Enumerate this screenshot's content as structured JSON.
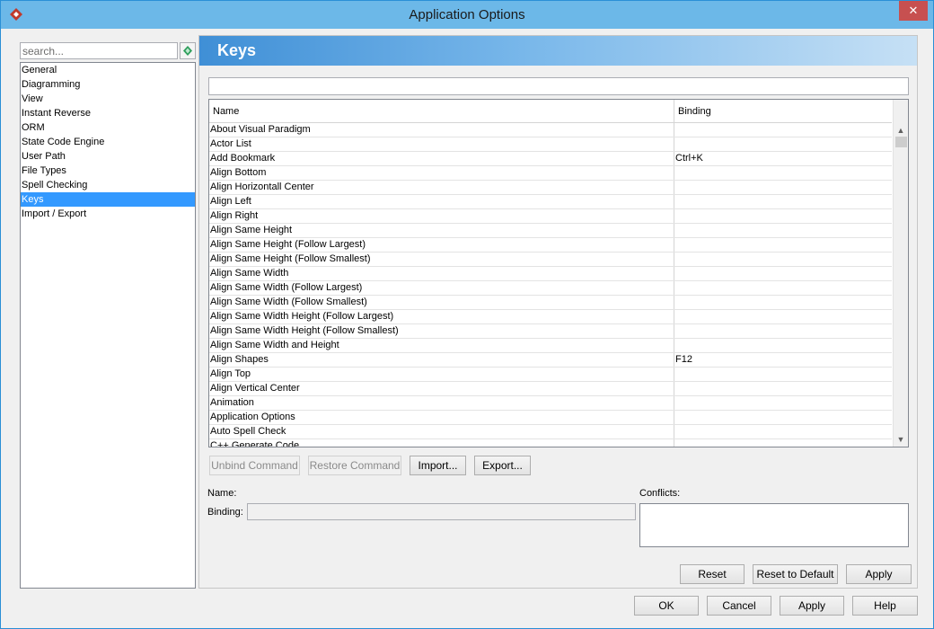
{
  "window": {
    "title": "Application Options",
    "close_glyph": "✕"
  },
  "search": {
    "placeholder": "search..."
  },
  "categories": [
    {
      "label": "General"
    },
    {
      "label": "Diagramming"
    },
    {
      "label": "View"
    },
    {
      "label": "Instant Reverse"
    },
    {
      "label": "ORM"
    },
    {
      "label": "State Code Engine"
    },
    {
      "label": "User Path"
    },
    {
      "label": "File Types"
    },
    {
      "label": "Spell Checking"
    },
    {
      "label": "Keys",
      "selected": true
    },
    {
      "label": "Import / Export"
    }
  ],
  "panel": {
    "title": "Keys"
  },
  "table": {
    "columns": {
      "name": "Name",
      "binding": "Binding"
    },
    "rows": [
      {
        "name": "About Visual Paradigm",
        "binding": ""
      },
      {
        "name": "Actor List",
        "binding": ""
      },
      {
        "name": "Add Bookmark",
        "binding": "Ctrl+K"
      },
      {
        "name": "Align Bottom",
        "binding": ""
      },
      {
        "name": "Align Horizontall Center",
        "binding": ""
      },
      {
        "name": "Align Left",
        "binding": ""
      },
      {
        "name": "Align Right",
        "binding": ""
      },
      {
        "name": "Align Same Height",
        "binding": ""
      },
      {
        "name": "Align Same Height (Follow Largest)",
        "binding": ""
      },
      {
        "name": "Align Same Height (Follow Smallest)",
        "binding": ""
      },
      {
        "name": "Align Same Width",
        "binding": ""
      },
      {
        "name": "Align Same Width (Follow Largest)",
        "binding": ""
      },
      {
        "name": "Align Same Width (Follow Smallest)",
        "binding": ""
      },
      {
        "name": "Align Same Width Height (Follow Largest)",
        "binding": ""
      },
      {
        "name": "Align Same Width Height (Follow Smallest)",
        "binding": ""
      },
      {
        "name": "Align Same Width and Height",
        "binding": ""
      },
      {
        "name": "Align Shapes",
        "binding": "F12"
      },
      {
        "name": "Align Top",
        "binding": ""
      },
      {
        "name": "Align Vertical Center",
        "binding": ""
      },
      {
        "name": "Animation",
        "binding": ""
      },
      {
        "name": "Application Options",
        "binding": ""
      },
      {
        "name": "Auto Spell Check",
        "binding": ""
      },
      {
        "name": "C++ Generate Code",
        "binding": ""
      }
    ]
  },
  "actions": {
    "unbind": "Unbind Command",
    "restore": "Restore Command",
    "import": "Import...",
    "export": "Export..."
  },
  "details": {
    "name_label": "Name:",
    "binding_label": "Binding:",
    "conflicts_label": "Conflicts:"
  },
  "panel_buttons": {
    "reset": "Reset",
    "reset_default": "Reset to Default",
    "apply": "Apply"
  },
  "dialog_buttons": {
    "ok": "OK",
    "cancel": "Cancel",
    "apply": "Apply",
    "help": "Help"
  },
  "colors": {
    "selection": "#3399ff",
    "header_start": "#3f8fd6",
    "header_end": "#c6e0f5",
    "titlebar": "#6cb8e8"
  }
}
